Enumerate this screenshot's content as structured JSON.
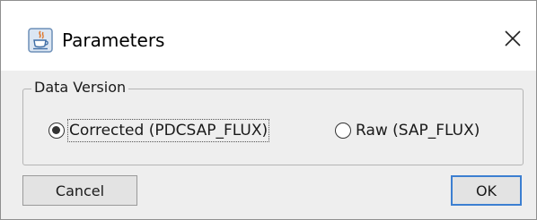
{
  "window": {
    "title": "Parameters",
    "app_icon": "java-cup-icon",
    "close_icon": "close-icon"
  },
  "group": {
    "label": "Data Version"
  },
  "options": [
    {
      "label": "Corrected (PDCSAP_FLUX)",
      "selected": true
    },
    {
      "label": "Raw (SAP_FLUX)",
      "selected": false
    }
  ],
  "buttons": {
    "cancel_label": "Cancel",
    "ok_label": "OK"
  },
  "colors": {
    "default_button_border": "#3c7fd1",
    "content_background": "#eeeeee"
  }
}
